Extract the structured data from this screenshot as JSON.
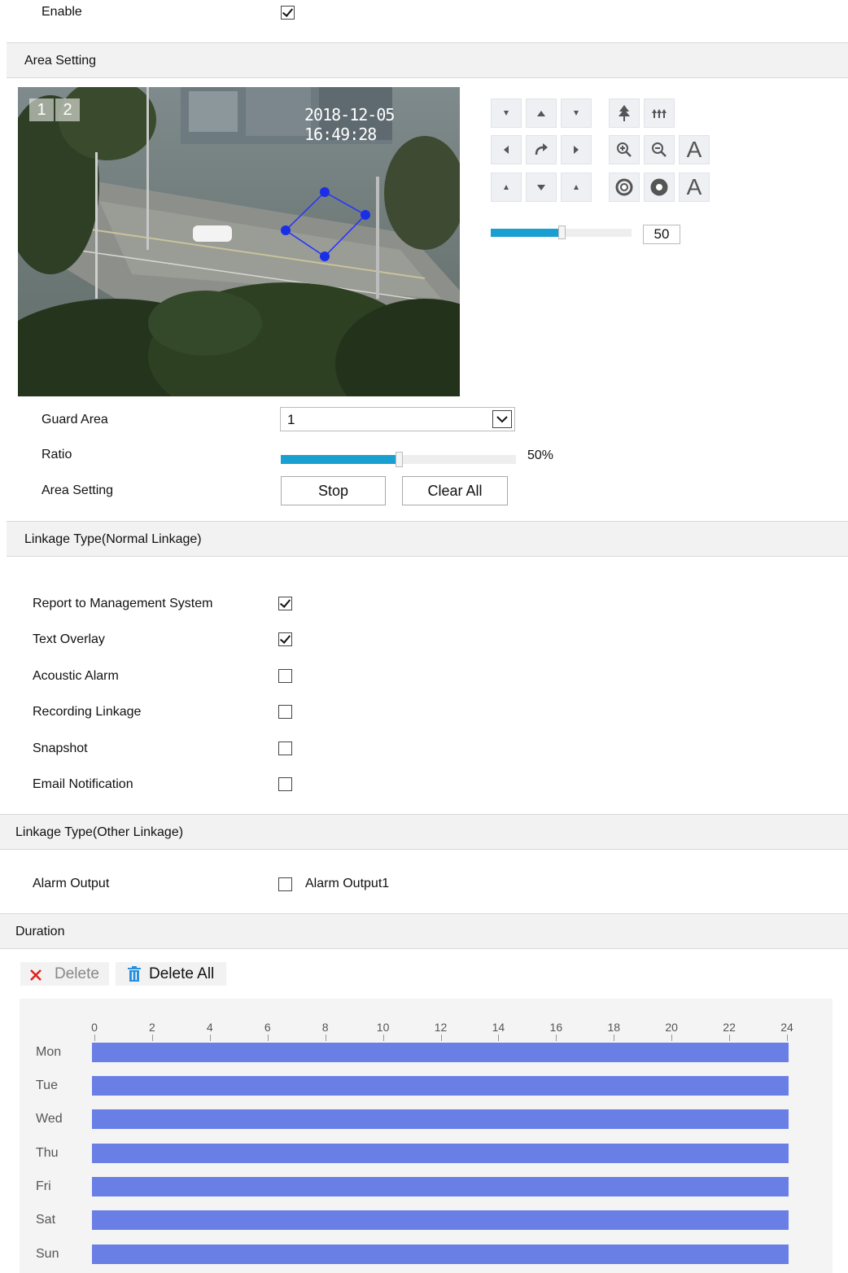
{
  "enable": {
    "label": "Enable",
    "checked": true
  },
  "area_section": {
    "title": "Area Setting"
  },
  "video": {
    "timestamp": "2018-12-05 16:49:28",
    "channels": [
      "1",
      "2"
    ]
  },
  "ptz": {
    "speed_value": "50",
    "speed_fraction": 0.5,
    "text_a1": "A",
    "text_a2": "A"
  },
  "form": {
    "guard_area_label": "Guard Area",
    "guard_area_value": "1",
    "ratio_label": "Ratio",
    "ratio_value": "50%",
    "ratio_fraction": 0.5,
    "area_setting_label": "Area Setting",
    "stop_label": "Stop",
    "clear_all_label": "Clear All"
  },
  "normal_linkage": {
    "title": "Linkage Type(Normal Linkage)",
    "items": [
      {
        "label": "Report to Management System",
        "checked": true
      },
      {
        "label": "Text Overlay",
        "checked": true
      },
      {
        "label": "Acoustic Alarm",
        "checked": false
      },
      {
        "label": "Recording Linkage",
        "checked": false
      },
      {
        "label": "Snapshot",
        "checked": false
      },
      {
        "label": "Email Notification",
        "checked": false
      }
    ]
  },
  "other_linkage": {
    "title": "Linkage Type(Other Linkage)",
    "alarm_output_label": "Alarm Output",
    "alarm_output1_label": "Alarm Output1",
    "alarm_output1_checked": false
  },
  "duration": {
    "title": "Duration",
    "delete_label": "Delete",
    "delete_all_label": "Delete All",
    "hours": [
      "0",
      "2",
      "4",
      "6",
      "8",
      "10",
      "12",
      "14",
      "16",
      "18",
      "20",
      "22",
      "24"
    ],
    "days": [
      "Mon",
      "Tue",
      "Wed",
      "Thu",
      "Fri",
      "Sat",
      "Sun"
    ],
    "schedule_color": "#6a7fe6"
  }
}
